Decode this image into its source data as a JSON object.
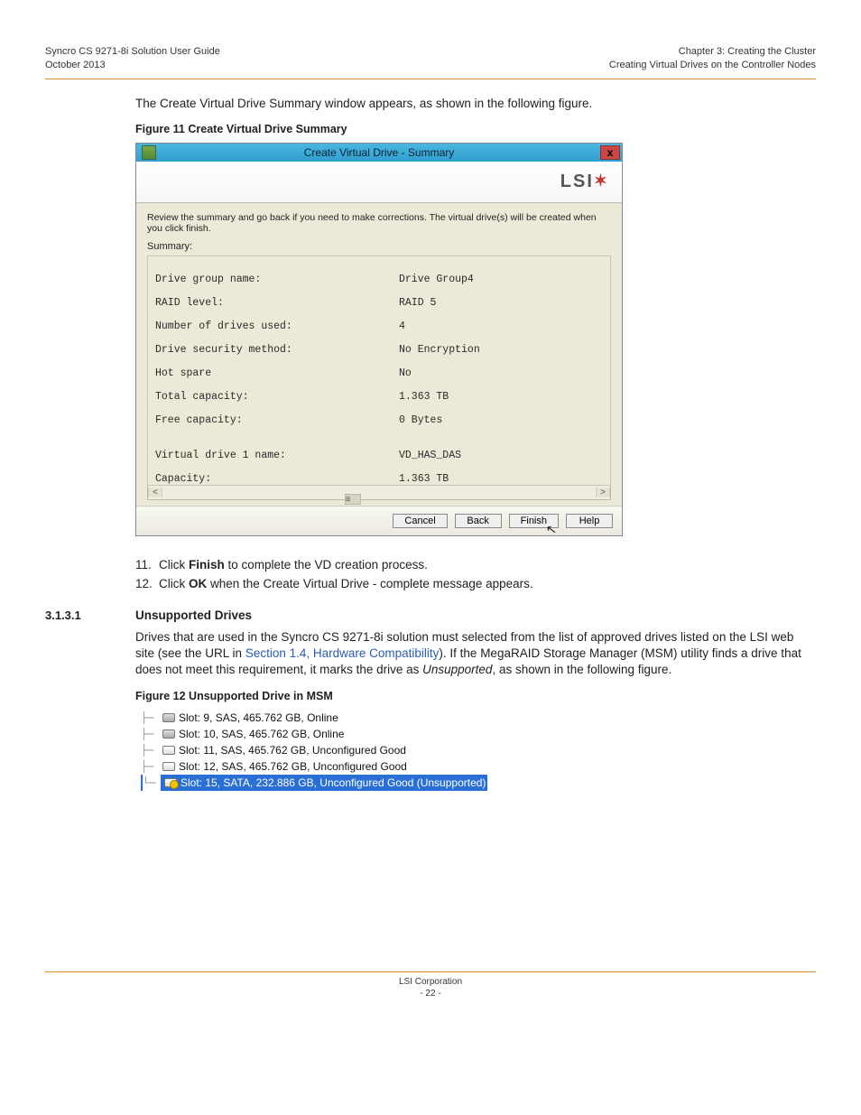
{
  "header": {
    "doc_title": "Syncro CS 9271-8i Solution User Guide",
    "doc_date": "October 2013",
    "chapter": "Chapter 3:  Creating the Cluster",
    "section": "Creating Virtual Drives on the Controller Nodes"
  },
  "intro_para": "The Create Virtual Drive Summary window appears, as shown in the following figure.",
  "fig11_caption": "Figure 11  Create Virtual Drive Summary",
  "dialog": {
    "title": "Create Virtual Drive - Summary",
    "close": "x",
    "logo": "LSI",
    "instruct": "Review the summary and go back if you need to make corrections. The virtual drive(s) will be created when you click finish.",
    "summary_label": "Summary:",
    "rows": [
      {
        "k": "Drive group name:",
        "v": "Drive Group4"
      },
      {
        "k": "RAID level:",
        "v": "RAID 5"
      },
      {
        "k": "Number of drives used:",
        "v": "4"
      },
      {
        "k": "Drive security method:",
        "v": "No Encryption"
      },
      {
        "k": "Hot spare",
        "v": "No"
      },
      {
        "k": "Total capacity:",
        "v": "1.363 TB"
      },
      {
        "k": "Free capacity:",
        "v": "0 Bytes"
      },
      {
        "k": "",
        "v": ""
      },
      {
        "k": "Virtual drive 1 name:",
        "v": "VD_HAS_DAS"
      },
      {
        "k": "Capacity:",
        "v": "1.363 TB"
      }
    ],
    "buttons": {
      "cancel": "Cancel",
      "back": "Back",
      "finish": "Finish",
      "help": "Help"
    }
  },
  "steps": {
    "s11_num": "11.",
    "s11_a": "Click ",
    "s11_b": "Finish",
    "s11_c": " to complete the VD creation process.",
    "s12_num": "12.",
    "s12_a": "Click ",
    "s12_b": "OK",
    "s12_c": " when the Create Virtual Drive - complete message appears."
  },
  "sect": {
    "num": "3.1.3.1",
    "title": "Unsupported Drives",
    "para_a": "Drives that are used in the Syncro CS 9271-8i solution must selected from the list of approved drives listed on the LSI web site (see the URL in ",
    "para_link": "Section 1.4, Hardware Compatibility",
    "para_b": "). If the MegaRAID Storage Manager (MSM) utility finds a drive that does not meet this requirement, it marks the drive as ",
    "para_italic": "Unsupported",
    "para_c": ", as shown in the following figure."
  },
  "fig12_caption": "Figure 12  Unsupported Drive in MSM",
  "tree": {
    "r1": "Slot: 9, SAS, 465.762 GB, Online",
    "r2": "Slot: 10, SAS, 465.762 GB, Online",
    "r3": "Slot: 11, SAS, 465.762 GB, Unconfigured Good",
    "r4": "Slot: 12, SAS, 465.762 GB, Unconfigured Good",
    "r5": "Slot: 15, SATA, 232.886 GB, Unconfigured Good (Unsupported)"
  },
  "footer": {
    "company": "LSI Corporation",
    "page": "- 22 -"
  }
}
